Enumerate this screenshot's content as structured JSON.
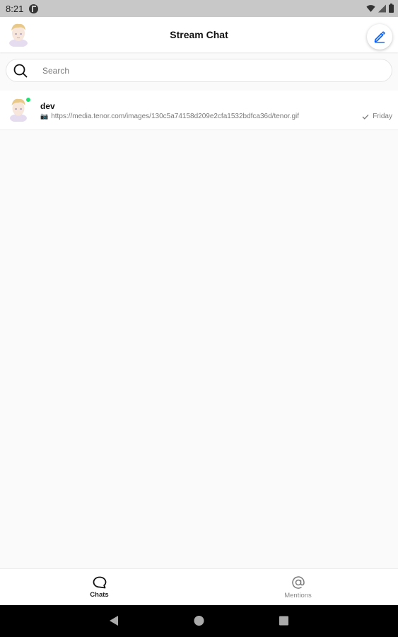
{
  "status_bar": {
    "time": "8:21"
  },
  "header": {
    "title": "Stream Chat"
  },
  "search": {
    "placeholder": "Search"
  },
  "channels": [
    {
      "name": "dev",
      "preview": "https://media.tenor.com/images/130c5a74158d209e2cfa1532bdfca36d/tenor.gif",
      "timestamp": "Friday",
      "online": true,
      "read": true
    }
  ],
  "bottom_nav": {
    "tabs": [
      {
        "label": "Chats",
        "active": true,
        "icon": "chat-bubble-icon"
      },
      {
        "label": "Mentions",
        "active": false,
        "icon": "at-sign-icon"
      }
    ]
  },
  "colors": {
    "accent": "#005fff",
    "online": "#20e070",
    "background": "#fafafa"
  }
}
